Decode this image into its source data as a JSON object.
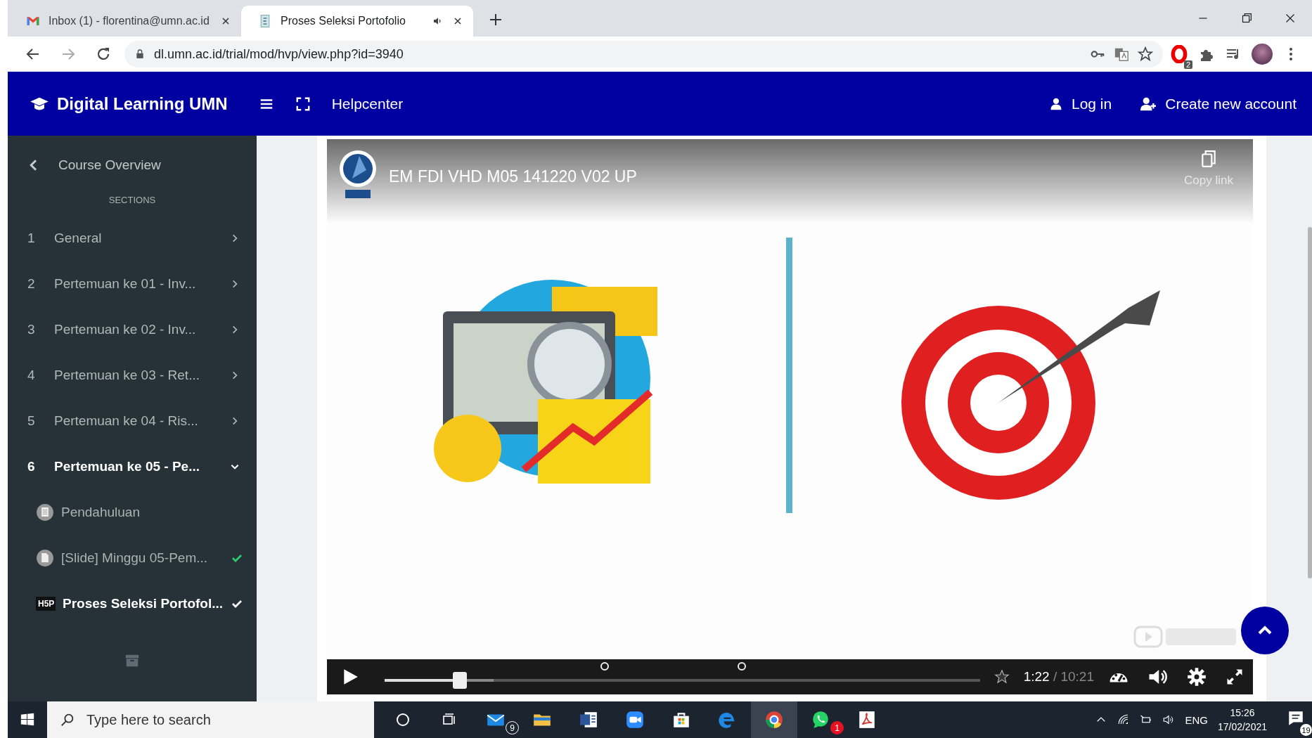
{
  "browser": {
    "tabs": [
      {
        "title": "Inbox (1) - florentina@umn.ac.id",
        "kind": "mail",
        "selected": false,
        "audio": false
      },
      {
        "title": "Proses Seleksi Portofolio",
        "kind": "doc",
        "selected": true,
        "audio": true
      }
    ],
    "address": "dl.umn.ac.id/trial/mod/hvp/view.php?id=3940",
    "extension_badge": "2"
  },
  "header": {
    "brand": "Digital Learning UMN",
    "links": [
      "Helpcenter"
    ],
    "login": "Log in",
    "signup": "Create new account"
  },
  "sidebar": {
    "back": "Course Overview",
    "heading": "SECTIONS",
    "sections": [
      {
        "number": "1",
        "label": "General",
        "expanded": false,
        "selected": false
      },
      {
        "number": "2",
        "label": "Pertemuan ke 01 - Inv...",
        "expanded": false,
        "selected": false
      },
      {
        "number": "3",
        "label": "Pertemuan ke 02 - Inv...",
        "expanded": false,
        "selected": false
      },
      {
        "number": "4",
        "label": "Pertemuan ke 03 - Ret...",
        "expanded": false,
        "selected": false
      },
      {
        "number": "5",
        "label": "Pertemuan ke 04 - Ris...",
        "expanded": false,
        "selected": false
      },
      {
        "number": "6",
        "label": "Pertemuan ke 05 - Pe...",
        "expanded": true,
        "selected": true,
        "children": [
          {
            "kind": "page",
            "label": "Pendahuluan",
            "completed": false,
            "selected": false
          },
          {
            "kind": "file",
            "label": "[Slide] Minggu 05-Pem...",
            "completed": true,
            "selected": false
          },
          {
            "kind": "hvp",
            "icon_text": "H5P",
            "label": "Proses Seleksi Portofol...",
            "completed": true,
            "selected": true
          }
        ]
      }
    ]
  },
  "video": {
    "title": "EM FDI VHD M05 141220 V02 UP",
    "copy_link": "Copy link",
    "progress": {
      "level": 0.126
    },
    "buffered": {
      "level": 0.183
    },
    "time": "1:22",
    "duration": "/ 10:21"
  },
  "taskbar": {
    "search": {
      "placeholder": "Type here to search"
    },
    "apps": [
      {
        "kind": "mail",
        "badge": "9",
        "selected": false
      },
      {
        "kind": "folder",
        "selected": false
      },
      {
        "kind": "word",
        "selected": false
      },
      {
        "kind": "zoom",
        "selected": false
      },
      {
        "kind": "store",
        "selected": false
      },
      {
        "kind": "edge",
        "selected": false
      },
      {
        "kind": "chrome",
        "selected": true
      },
      {
        "kind": "whatsapp",
        "badge": "1",
        "selected": false
      },
      {
        "kind": "acrobat",
        "selected": false
      }
    ],
    "tray": {
      "language": "ENG",
      "time": "15:26",
      "date": "17/02/2021",
      "notifications": "19"
    }
  }
}
